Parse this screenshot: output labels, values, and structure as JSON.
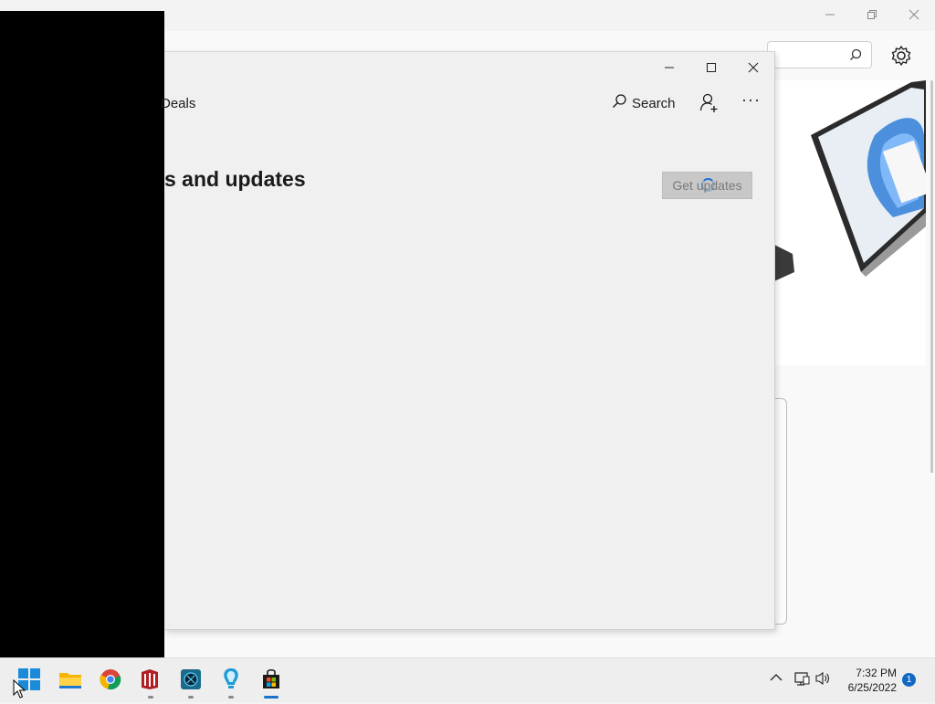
{
  "store_window": {
    "nav": {
      "deals_label": "Deals",
      "search_label": "Search",
      "more_label": "···"
    },
    "heading": "s and updates",
    "get_updates_label": "Get updates"
  },
  "taskbar": {
    "apps": [
      "start-icon",
      "file-explorer-icon",
      "chrome-icon",
      "app-icon",
      "app-icon-2",
      "app-icon-3",
      "store-icon"
    ],
    "clock_time": "7:32 PM",
    "clock_date": "6/25/2022",
    "notification_count": "1"
  },
  "colors": {
    "accent": "#1a73c8",
    "store_bg": "#f0f0f0",
    "taskbar_bg": "#eeeeee"
  }
}
